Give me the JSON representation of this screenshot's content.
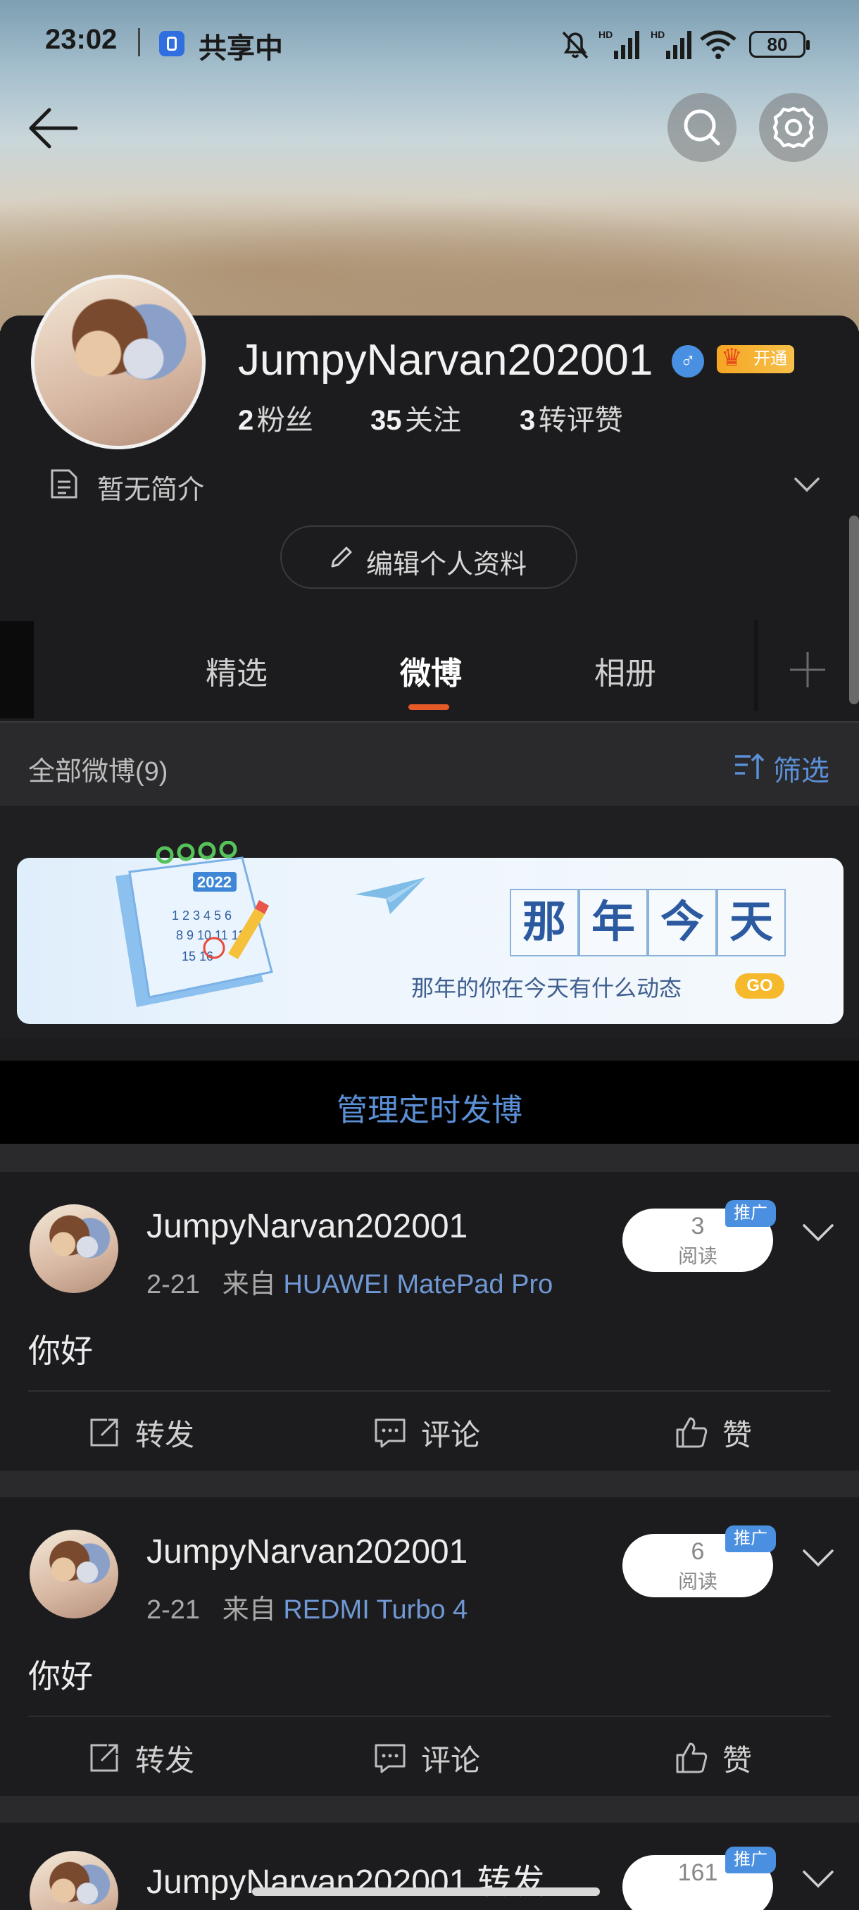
{
  "status_bar": {
    "time": "23:02",
    "sharing": "共享中",
    "battery": "80"
  },
  "profile": {
    "username": "JumpyNarvan202001",
    "vip_label": "开通",
    "stats": [
      {
        "num": "2",
        "label": "粉丝"
      },
      {
        "num": "35",
        "label": "关注"
      },
      {
        "num": "3",
        "label": "转评赞"
      }
    ],
    "bio": "暂无简介",
    "edit_label": "编辑个人资料"
  },
  "tabs": {
    "featured": "精选",
    "weibo": "微博",
    "album": "相册"
  },
  "filter_bar": {
    "all_count": "全部微博(9)",
    "filter_label": "筛选"
  },
  "banner": {
    "year": "2022",
    "title_chars": [
      "那",
      "年",
      "今",
      "天"
    ],
    "subtitle": "那年的你在今天有什么动态",
    "go": "GO"
  },
  "manage": {
    "label": "管理定时发博"
  },
  "posts": [
    {
      "name": "JumpyNarvan202001",
      "date": "2-21",
      "from_prefix": "来自",
      "source": "HUAWEI MatePad Pro",
      "read_count": "3",
      "read_label": "阅读",
      "promo": "推广",
      "body": "你好",
      "actions": {
        "repost": "转发",
        "comment": "评论",
        "like": "赞"
      }
    },
    {
      "name": "JumpyNarvan202001",
      "date": "2-21",
      "from_prefix": "来自",
      "source": "REDMI Turbo 4",
      "read_count": "6",
      "read_label": "阅读",
      "promo": "推广",
      "body": "你好",
      "actions": {
        "repost": "转发",
        "comment": "评论",
        "like": "赞"
      }
    },
    {
      "name": "JumpyNarvan202001 转发",
      "read_count": "161",
      "promo": "推广"
    }
  ],
  "colors": {
    "accent": "#e65a2a",
    "link": "#5b8fd6",
    "promo": "#4a8fe0",
    "vip": "#f5a623"
  }
}
